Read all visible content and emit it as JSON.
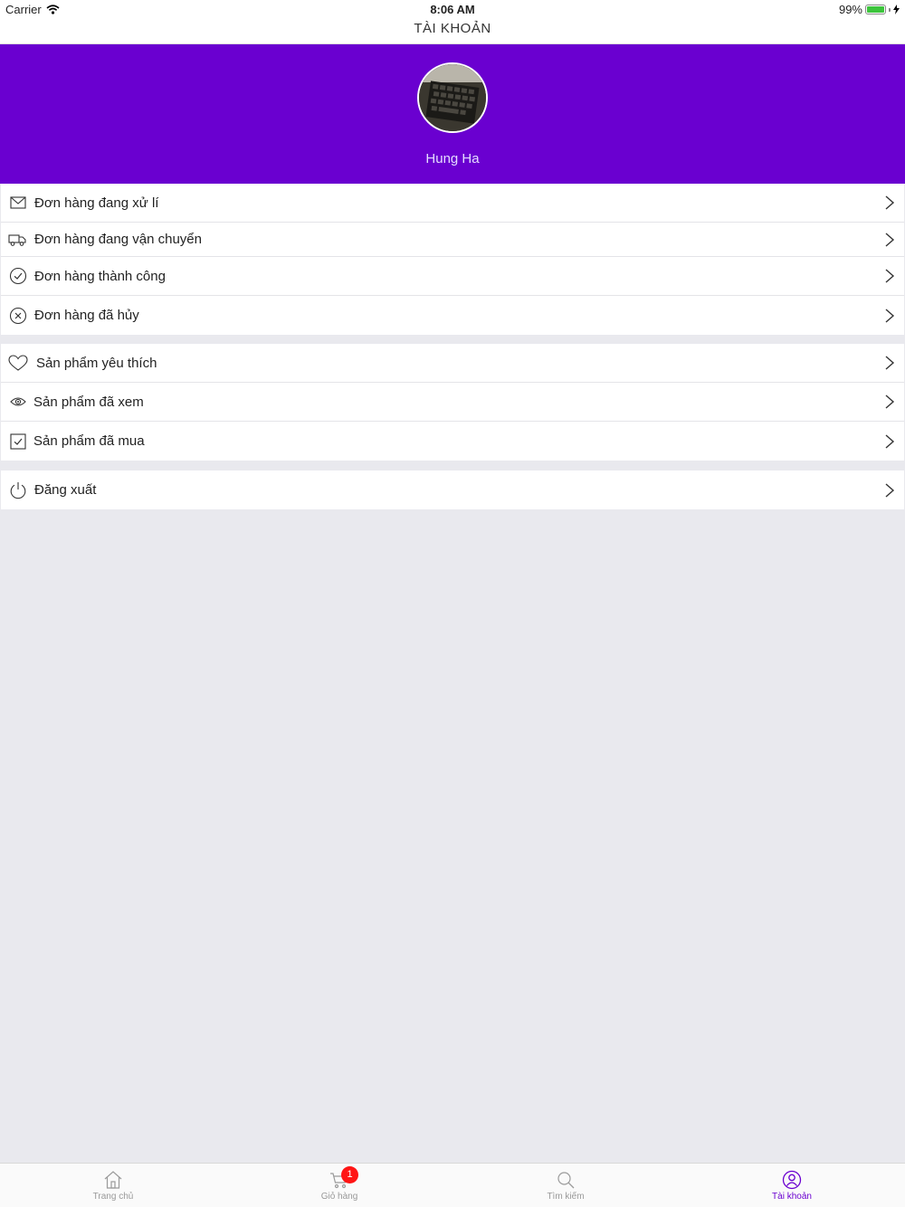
{
  "status_bar": {
    "carrier": "Carrier",
    "time": "8:06 AM",
    "battery": "99%"
  },
  "nav": {
    "title": "TÀI KHOẢN"
  },
  "profile": {
    "name": "Hung Ha"
  },
  "orders": [
    {
      "label": "Đơn hàng đang xử lí",
      "icon": "inbox-icon"
    },
    {
      "label": "Đơn hàng đang vận chuyển",
      "icon": "truck-icon"
    },
    {
      "label": "Đơn hàng thành công",
      "icon": "check-circle-icon"
    },
    {
      "label": "Đơn hàng đã hủy",
      "icon": "x-circle-icon"
    }
  ],
  "products": [
    {
      "label": "Sản phẩm yêu thích",
      "icon": "heart-icon"
    },
    {
      "label": "Sản phẩm đã xem",
      "icon": "eye-icon"
    },
    {
      "label": "Sản phẩm đã mua",
      "icon": "checkbox-icon"
    }
  ],
  "account": [
    {
      "label": "Đăng xuất",
      "icon": "power-icon"
    }
  ],
  "tabs": [
    {
      "label": "Trang chủ",
      "icon": "home-icon",
      "active": false
    },
    {
      "label": "Giỏ hàng",
      "icon": "cart-icon",
      "active": false,
      "badge": "1"
    },
    {
      "label": "Tìm kiếm",
      "icon": "search-icon",
      "active": false
    },
    {
      "label": "Tài khoản",
      "icon": "user-icon",
      "active": true
    }
  ],
  "colors": {
    "brand": "#6a00d0",
    "badge": "#ff1515",
    "background": "#e9e9ee"
  }
}
